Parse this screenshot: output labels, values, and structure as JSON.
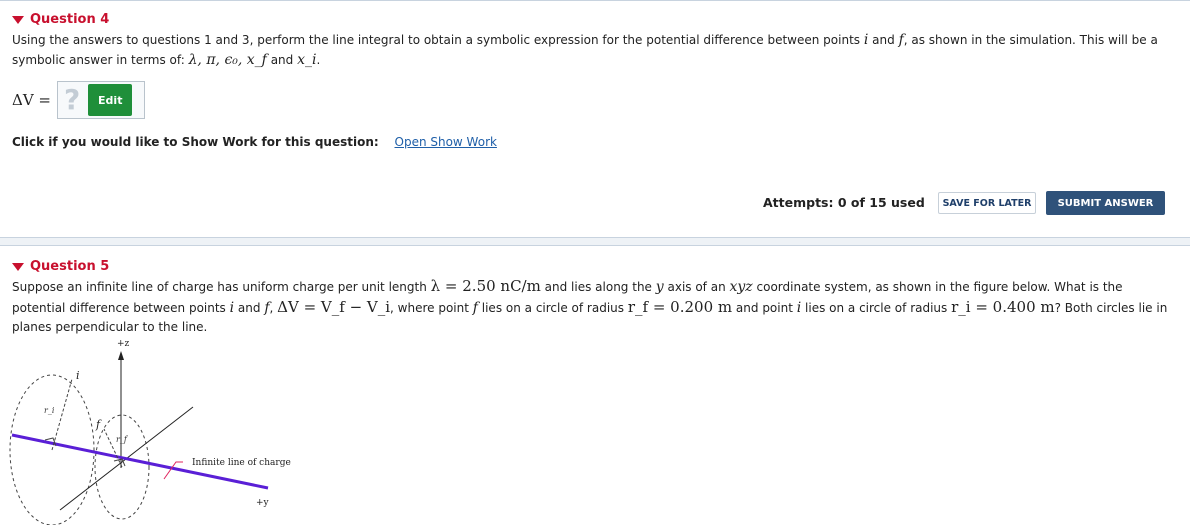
{
  "q4": {
    "title": "Question 4",
    "text_a": "Using the answers to questions 1 and 3, perform the line integral to obtain a symbolic expression for the potential difference between points ",
    "sym_i": "i",
    "text_b": " and ",
    "sym_f": "f",
    "text_c": ", as shown in the simulation. This will be a symbolic answer in terms of: ",
    "sym_terms": "λ, π, ϵ₀, x_f",
    "text_and": " and ",
    "sym_xi": "x_i",
    "text_end": ".",
    "answer_label": "ΔV =",
    "answer_placeholder": "?",
    "edit_label": "Edit",
    "showwork_label": "Click if you would like to Show Work for this question:",
    "showwork_link": "Open Show Work",
    "attempts": "Attempts: 0 of 15 used",
    "save_label": "SAVE FOR LATER",
    "submit_label": "SUBMIT ANSWER"
  },
  "q5": {
    "title": "Question 5",
    "text_a": "Suppose an infinite line of charge has uniform charge per unit length ",
    "lambda_eq": "λ = 2.50 nC/m",
    "text_b": " and lies along the ",
    "sym_y": "y",
    "text_c": " axis of an ",
    "sym_xyz": "xyz",
    "text_d": " coordinate system, as shown in the figure below. What is the potential difference between points ",
    "sym_i": "i",
    "text_e": " and ",
    "sym_f": "f",
    "text_f": ", ",
    "dv_eq": "ΔV = V_f − V_i",
    "text_g": ", where point ",
    "sym_f2": "f",
    "text_h": " lies on a circle of radius ",
    "rf_eq": "r_f = 0.200 m",
    "text_i": " and point ",
    "sym_i2": "i",
    "text_j": " lies on a circle of radius ",
    "ri_eq": "r_i = 0.400 m",
    "text_k": "? Both circles lie in planes perpendicular to the line."
  },
  "figure": {
    "axis_z": "+z",
    "axis_y": "+y",
    "point_i": "i",
    "point_f": "f",
    "radius_i": "r_i",
    "radius_f": "r_f",
    "line_label": "Infinite line of charge",
    "line_color": "#5a1fd6",
    "label_line_color": "#e0245e"
  }
}
